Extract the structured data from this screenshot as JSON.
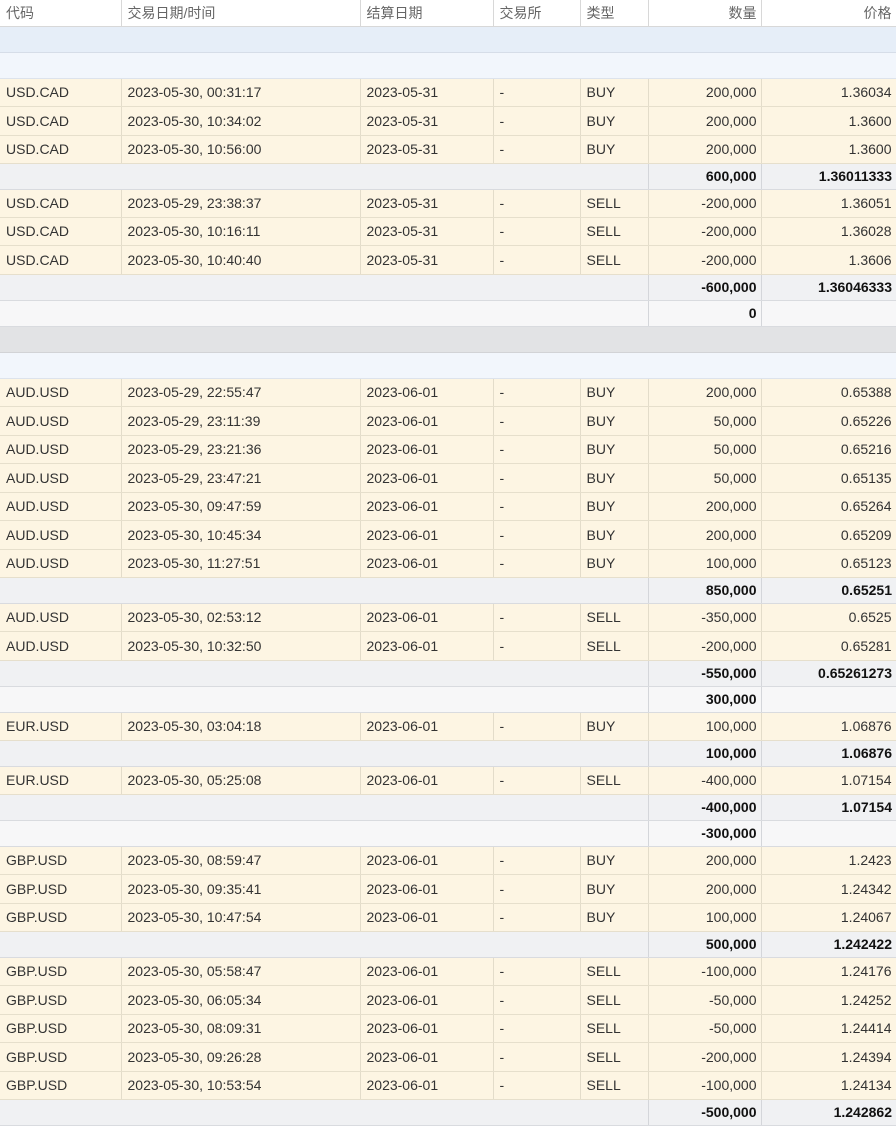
{
  "columns": [
    "代码",
    "交易日期/时间",
    "结算日期",
    "交易所",
    "类型",
    "数量",
    "价格"
  ],
  "rows": [
    {
      "kind": "blank",
      "style": "blue",
      "h": 26
    },
    {
      "kind": "blank",
      "style": "pale",
      "h": 26
    },
    {
      "kind": "trade",
      "h": 28,
      "cells": [
        "USD.CAD",
        "2023-05-30, 00:31:17",
        "2023-05-31",
        "-",
        "BUY",
        "200,000",
        "1.36034"
      ]
    },
    {
      "kind": "trade",
      "h": 29,
      "cells": [
        "USD.CAD",
        "2023-05-30, 10:34:02",
        "2023-05-31",
        "-",
        "BUY",
        "200,000",
        "1.3600"
      ]
    },
    {
      "kind": "trade",
      "h": 28,
      "cells": [
        "USD.CAD",
        "2023-05-30, 10:56:00",
        "2023-05-31",
        "-",
        "BUY",
        "200,000",
        "1.3600"
      ]
    },
    {
      "kind": "sub",
      "h": 26,
      "qty": "600,000",
      "price": "1.36011333"
    },
    {
      "kind": "trade",
      "h": 28,
      "cells": [
        "USD.CAD",
        "2023-05-29, 23:38:37",
        "2023-05-31",
        "-",
        "SELL",
        "-200,000",
        "1.36051"
      ]
    },
    {
      "kind": "trade",
      "h": 28,
      "cells": [
        "USD.CAD",
        "2023-05-30, 10:16:11",
        "2023-05-31",
        "-",
        "SELL",
        "-200,000",
        "1.36028"
      ]
    },
    {
      "kind": "trade",
      "h": 29,
      "cells": [
        "USD.CAD",
        "2023-05-30, 10:40:40",
        "2023-05-31",
        "-",
        "SELL",
        "-200,000",
        "1.3606"
      ]
    },
    {
      "kind": "sub",
      "h": 26,
      "qty": "-600,000",
      "price": "1.36046333"
    },
    {
      "kind": "net",
      "h": 26,
      "qty": "0"
    },
    {
      "kind": "blank",
      "style": "gray",
      "h": 26
    },
    {
      "kind": "blank",
      "style": "pale",
      "h": 26
    },
    {
      "kind": "trade",
      "h": 28,
      "cells": [
        "AUD.USD",
        "2023-05-29, 22:55:47",
        "2023-06-01",
        "-",
        "BUY",
        "200,000",
        "0.65388"
      ]
    },
    {
      "kind": "trade",
      "h": 29,
      "cells": [
        "AUD.USD",
        "2023-05-29, 23:11:39",
        "2023-06-01",
        "-",
        "BUY",
        "50,000",
        "0.65226"
      ]
    },
    {
      "kind": "trade",
      "h": 28,
      "cells": [
        "AUD.USD",
        "2023-05-29, 23:21:36",
        "2023-06-01",
        "-",
        "BUY",
        "50,000",
        "0.65216"
      ]
    },
    {
      "kind": "trade",
      "h": 29,
      "cells": [
        "AUD.USD",
        "2023-05-29, 23:47:21",
        "2023-06-01",
        "-",
        "BUY",
        "50,000",
        "0.65135"
      ]
    },
    {
      "kind": "trade",
      "h": 28,
      "cells": [
        "AUD.USD",
        "2023-05-30, 09:47:59",
        "2023-06-01",
        "-",
        "BUY",
        "200,000",
        "0.65264"
      ]
    },
    {
      "kind": "trade",
      "h": 29,
      "cells": [
        "AUD.USD",
        "2023-05-30, 10:45:34",
        "2023-06-01",
        "-",
        "BUY",
        "200,000",
        "0.65209"
      ]
    },
    {
      "kind": "trade",
      "h": 28,
      "cells": [
        "AUD.USD",
        "2023-05-30, 11:27:51",
        "2023-06-01",
        "-",
        "BUY",
        "100,000",
        "0.65123"
      ]
    },
    {
      "kind": "sub",
      "h": 26,
      "qty": "850,000",
      "price": "0.65251"
    },
    {
      "kind": "trade",
      "h": 28,
      "cells": [
        "AUD.USD",
        "2023-05-30, 02:53:12",
        "2023-06-01",
        "-",
        "SELL",
        "-350,000",
        "0.6525"
      ]
    },
    {
      "kind": "trade",
      "h": 29,
      "cells": [
        "AUD.USD",
        "2023-05-30, 10:32:50",
        "2023-06-01",
        "-",
        "SELL",
        "-200,000",
        "0.65281"
      ]
    },
    {
      "kind": "sub",
      "h": 26,
      "qty": "-550,000",
      "price": "0.65261273"
    },
    {
      "kind": "net",
      "h": 26,
      "qty": "300,000"
    },
    {
      "kind": "trade",
      "h": 28,
      "cells": [
        "EUR.USD",
        "2023-05-30, 03:04:18",
        "2023-06-01",
        "-",
        "BUY",
        "100,000",
        "1.06876"
      ]
    },
    {
      "kind": "sub",
      "h": 26,
      "qty": "100,000",
      "price": "1.06876"
    },
    {
      "kind": "trade",
      "h": 28,
      "cells": [
        "EUR.USD",
        "2023-05-30, 05:25:08",
        "2023-06-01",
        "-",
        "SELL",
        "-400,000",
        "1.07154"
      ]
    },
    {
      "kind": "sub",
      "h": 26,
      "qty": "-400,000",
      "price": "1.07154"
    },
    {
      "kind": "net",
      "h": 26,
      "qty": "-300,000"
    },
    {
      "kind": "trade",
      "h": 28,
      "cells": [
        "GBP.USD",
        "2023-05-30, 08:59:47",
        "2023-06-01",
        "-",
        "BUY",
        "200,000",
        "1.2423"
      ]
    },
    {
      "kind": "trade",
      "h": 29,
      "cells": [
        "GBP.USD",
        "2023-05-30, 09:35:41",
        "2023-06-01",
        "-",
        "BUY",
        "200,000",
        "1.24342"
      ]
    },
    {
      "kind": "trade",
      "h": 28,
      "cells": [
        "GBP.USD",
        "2023-05-30, 10:47:54",
        "2023-06-01",
        "-",
        "BUY",
        "100,000",
        "1.24067"
      ]
    },
    {
      "kind": "sub",
      "h": 26,
      "qty": "500,000",
      "price": "1.242422"
    },
    {
      "kind": "trade",
      "h": 28,
      "cells": [
        "GBP.USD",
        "2023-05-30, 05:58:47",
        "2023-06-01",
        "-",
        "SELL",
        "-100,000",
        "1.24176"
      ]
    },
    {
      "kind": "trade",
      "h": 29,
      "cells": [
        "GBP.USD",
        "2023-05-30, 06:05:34",
        "2023-06-01",
        "-",
        "SELL",
        "-50,000",
        "1.24252"
      ]
    },
    {
      "kind": "trade",
      "h": 28,
      "cells": [
        "GBP.USD",
        "2023-05-30, 08:09:31",
        "2023-06-01",
        "-",
        "SELL",
        "-50,000",
        "1.24414"
      ]
    },
    {
      "kind": "trade",
      "h": 29,
      "cells": [
        "GBP.USD",
        "2023-05-30, 09:26:28",
        "2023-06-01",
        "-",
        "SELL",
        "-200,000",
        "1.24394"
      ]
    },
    {
      "kind": "trade",
      "h": 28,
      "cells": [
        "GBP.USD",
        "2023-05-30, 10:53:54",
        "2023-06-01",
        "-",
        "SELL",
        "-100,000",
        "1.24134"
      ]
    },
    {
      "kind": "sub",
      "h": 26,
      "qty": "-500,000",
      "price": "1.242862"
    }
  ]
}
